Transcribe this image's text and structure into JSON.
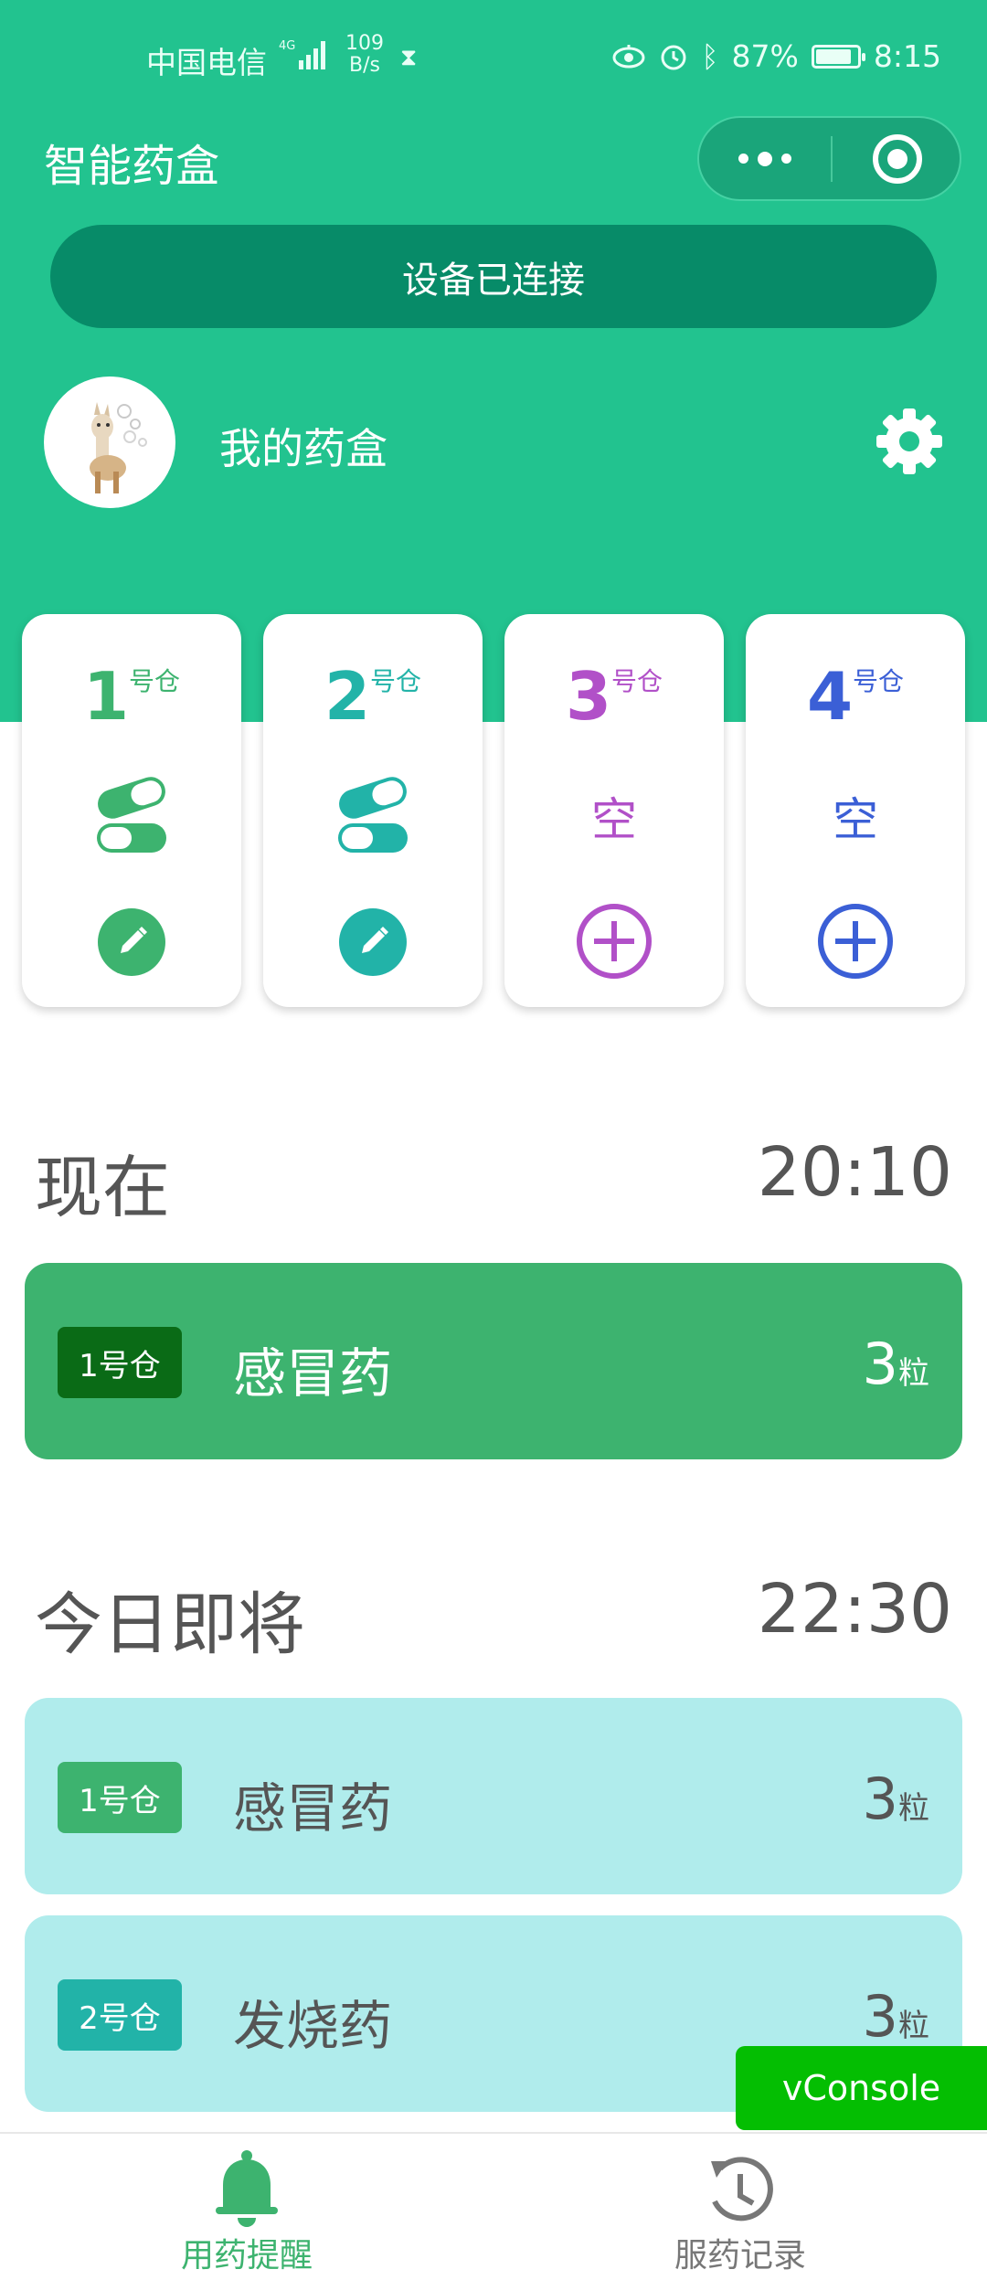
{
  "status_bar": {
    "carrier": "中国电信",
    "network": "4G",
    "speed_value": "109",
    "speed_unit": "B/s",
    "battery": "87%",
    "battery_level": 0.87,
    "time": "8:15"
  },
  "nav": {
    "title": "智能药盒"
  },
  "device": {
    "status": "设备已连接",
    "name": "我的药盒"
  },
  "bins": [
    {
      "num": "1",
      "suffix": "号仓",
      "color": "#3db36f",
      "state": "pill"
    },
    {
      "num": "2",
      "suffix": "号仓",
      "color": "#22b3a8",
      "state": "pill"
    },
    {
      "num": "3",
      "suffix": "号仓",
      "color": "#b150c8",
      "state": "empty",
      "empty_label": "空"
    },
    {
      "num": "4",
      "suffix": "号仓",
      "color": "#3b5fd6",
      "state": "empty",
      "empty_label": "空"
    }
  ],
  "now": {
    "title": "现在",
    "time": "20:10",
    "items": [
      {
        "bin": "1号仓",
        "name": "感冒药",
        "count": "3",
        "unit": "粒"
      }
    ]
  },
  "upcoming": {
    "title": "今日即将",
    "time": "22:30",
    "items": [
      {
        "bin": "1号仓",
        "name": "感冒药",
        "count": "3",
        "unit": "粒"
      },
      {
        "bin": "2号仓",
        "name": "发烧药",
        "count": "3",
        "unit": "粒"
      }
    ]
  },
  "vconsole": "vConsole",
  "tabs": [
    {
      "label": "用药提醒",
      "icon": "bell-icon",
      "active": true
    },
    {
      "label": "服药记录",
      "icon": "history-icon",
      "active": false
    }
  ],
  "colors": {
    "brand": "#22c38f",
    "now_card": "#3db36f",
    "upcoming_card": "#b0ecec",
    "tag_dark": "#0a6b16"
  }
}
